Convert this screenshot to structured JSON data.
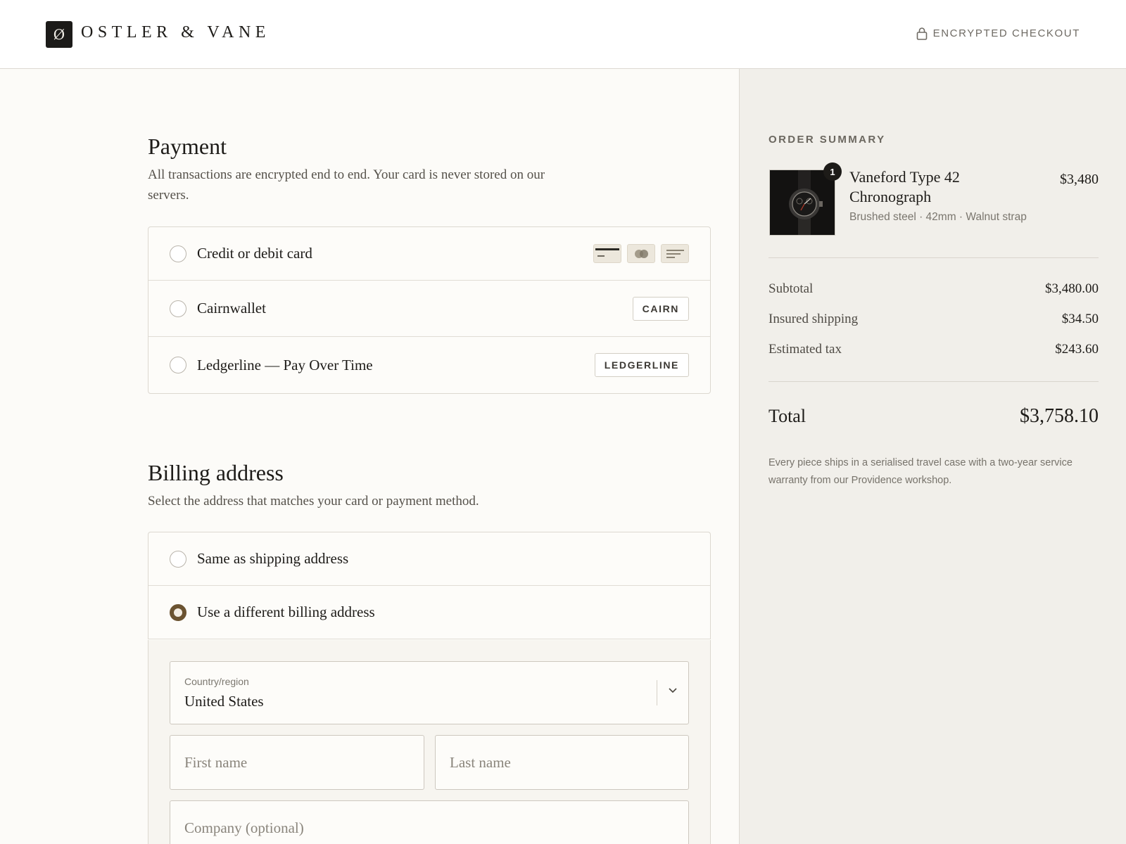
{
  "header": {
    "logo_glyph": "Ø",
    "brand": "OSTLER & VANE",
    "secure_label": "ENCRYPTED CHECKOUT",
    "secure_icon": "lock-icon"
  },
  "payment": {
    "title": "Payment",
    "description": "All transactions are encrypted end to end. Your card is never stored on our servers.",
    "options": [
      {
        "label": "Credit or debit card",
        "selected": false,
        "badge": null,
        "icons": [
          "card-brand-icon-1",
          "card-brand-icon-2",
          "card-brand-icon-3"
        ]
      },
      {
        "label": "Cairnwallet",
        "selected": false,
        "badge": "CAIRN"
      },
      {
        "label": "Ledgerline — Pay Over Time",
        "selected": false,
        "badge": "LEDGERLINE"
      }
    ]
  },
  "billing": {
    "title": "Billing address",
    "description": "Select the address that matches your card or payment method.",
    "options": [
      {
        "label": "Same as shipping address",
        "selected": false
      },
      {
        "label": "Use a different billing address",
        "selected": true
      }
    ],
    "form": {
      "country_label": "Country/region",
      "country_value": "United States",
      "first_name_placeholder": "First name",
      "last_name_placeholder": "Last name",
      "company_placeholder": "Company (optional)"
    }
  },
  "summary": {
    "title": "ORDER SUMMARY",
    "item": {
      "name": "Vaneford Type 42 Chronograph",
      "variant": "Brushed steel · 42mm · Walnut strap",
      "price": "$3,480",
      "quantity": "1"
    },
    "rows": [
      {
        "label": "Subtotal",
        "value": "$3,480.00"
      },
      {
        "label": "Insured shipping",
        "value": "$34.50"
      },
      {
        "label": "Estimated tax",
        "value": "$243.60"
      }
    ],
    "total_label": "Total",
    "total_value": "$3,758.10",
    "note": "Every piece ships in a serialised travel case with a two-year service warranty from our Providence workshop."
  },
  "colors": {
    "accent": "#6b5331",
    "sidebar_bg": "#f1efea",
    "page_bg": "#fcfbf8"
  }
}
